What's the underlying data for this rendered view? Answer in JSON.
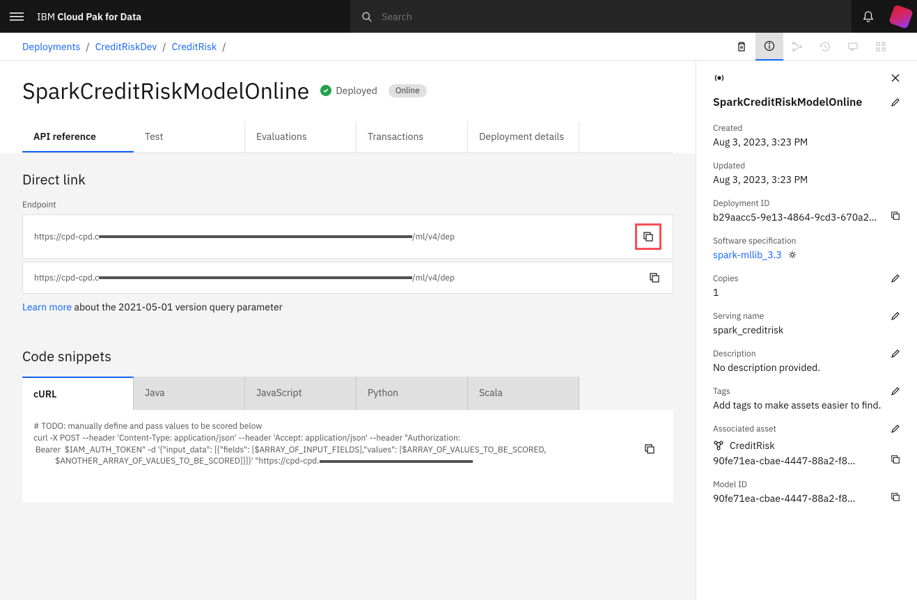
{
  "header": {
    "brand_prefix": "IBM ",
    "brand_main": "Cloud Pak for Data",
    "search_placeholder": "Search"
  },
  "breadcrumbs": [
    "Deployments",
    "CreditRiskDev",
    "CreditRisk"
  ],
  "page": {
    "title": "SparkCreditRiskModelOnline",
    "status": "Deployed",
    "mode": "Online"
  },
  "tabs": [
    "API reference",
    "Test",
    "Evaluations",
    "Transactions",
    "Deployment details"
  ],
  "direct_link": {
    "heading": "Direct link",
    "label": "Endpoint",
    "endpoint_prefix": "https://cpd-cpd.c",
    "endpoint_suffix": "/ml/v4/de",
    "learn_more": "Learn more",
    "help_text": " about the 2021-05-01 version query parameter"
  },
  "code_snippets": {
    "heading": "Code snippets",
    "langs": [
      "cURL",
      "Java",
      "JavaScript",
      "Python",
      "Scala"
    ],
    "curl_code": "# TODO: manually define and pass values to be scored below\ncurl -X POST --header 'Content-Type: application/json' --header 'Accept: application/json' --header \"Authorization:\n Bearer  $IAM_AUTH_TOKEN\" -d '{\"input_data\": [{\"fields\": [$ARRAY_OF_INPUT_FIELDS],\"values\": [$ARRAY_OF_VALUES_TO_BE_SCORED,\n           $ANOTHER_ARRAY_OF_VALUES_TO_BE_SCORED]}]}' \"https://cpd-cpd."
  },
  "info": {
    "title": "SparkCreditRiskModelOnline",
    "created_label": "Created",
    "created": "Aug 3, 2023, 3:23 PM",
    "updated_label": "Updated",
    "updated": "Aug 3, 2023, 3:23 PM",
    "deployment_id_label": "Deployment ID",
    "deployment_id": "b29aacc5-9e13-4864-9cd3-670a2…",
    "software_spec_label": "Software specification",
    "software_spec": "spark-mllib_3.3",
    "copies_label": "Copies",
    "copies": "1",
    "serving_name_label": "Serving name",
    "serving_name": "spark_creditrisk",
    "description_label": "Description",
    "description": "No description provided.",
    "tags_label": "Tags",
    "tags": "Add tags to make assets easier to find.",
    "associated_asset_label": "Associated asset",
    "associated_asset_name": "CreditRisk",
    "associated_asset_id": "90fe71ea-cbae-4447-88a2-f8…",
    "model_id_label": "Model ID",
    "model_id": "90fe71ea-cbae-4447-88a2-f8…"
  }
}
